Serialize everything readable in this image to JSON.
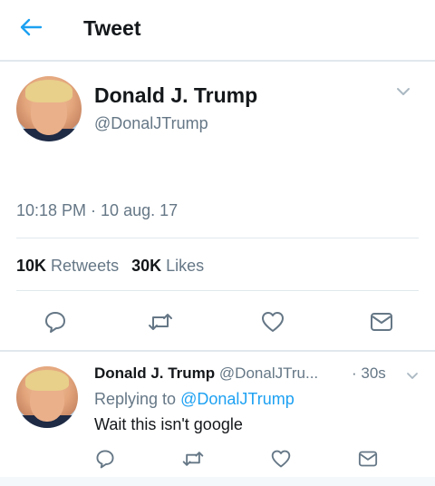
{
  "header": {
    "back_icon": "arrow-left-icon",
    "title": "Tweet"
  },
  "tweet": {
    "author_name": "Donald J. Trump",
    "author_handle": "@DonalJTrump",
    "timestamp": "10:18 PM · 10 aug. 17",
    "retweets_count": "10K",
    "retweets_label": "Retweets",
    "likes_count": "30K",
    "likes_label": "Likes",
    "actions": [
      "reply-icon",
      "retweet-icon",
      "like-icon",
      "message-icon"
    ]
  },
  "reply": {
    "author_name": "Donald J. Trump",
    "author_handle": "@DonalJTru...",
    "time": "· 30s",
    "replying_prefix": "Replying to",
    "replying_mention": "@DonalJTrump",
    "text": "Wait this isn't google",
    "actions": [
      "reply-icon",
      "retweet-icon",
      "like-icon",
      "message-icon"
    ]
  },
  "colors": {
    "accent": "#1da1f2",
    "text_primary": "#14171a",
    "text_secondary": "#657786",
    "divider": "#e1e8ed",
    "icon": "#657786"
  }
}
